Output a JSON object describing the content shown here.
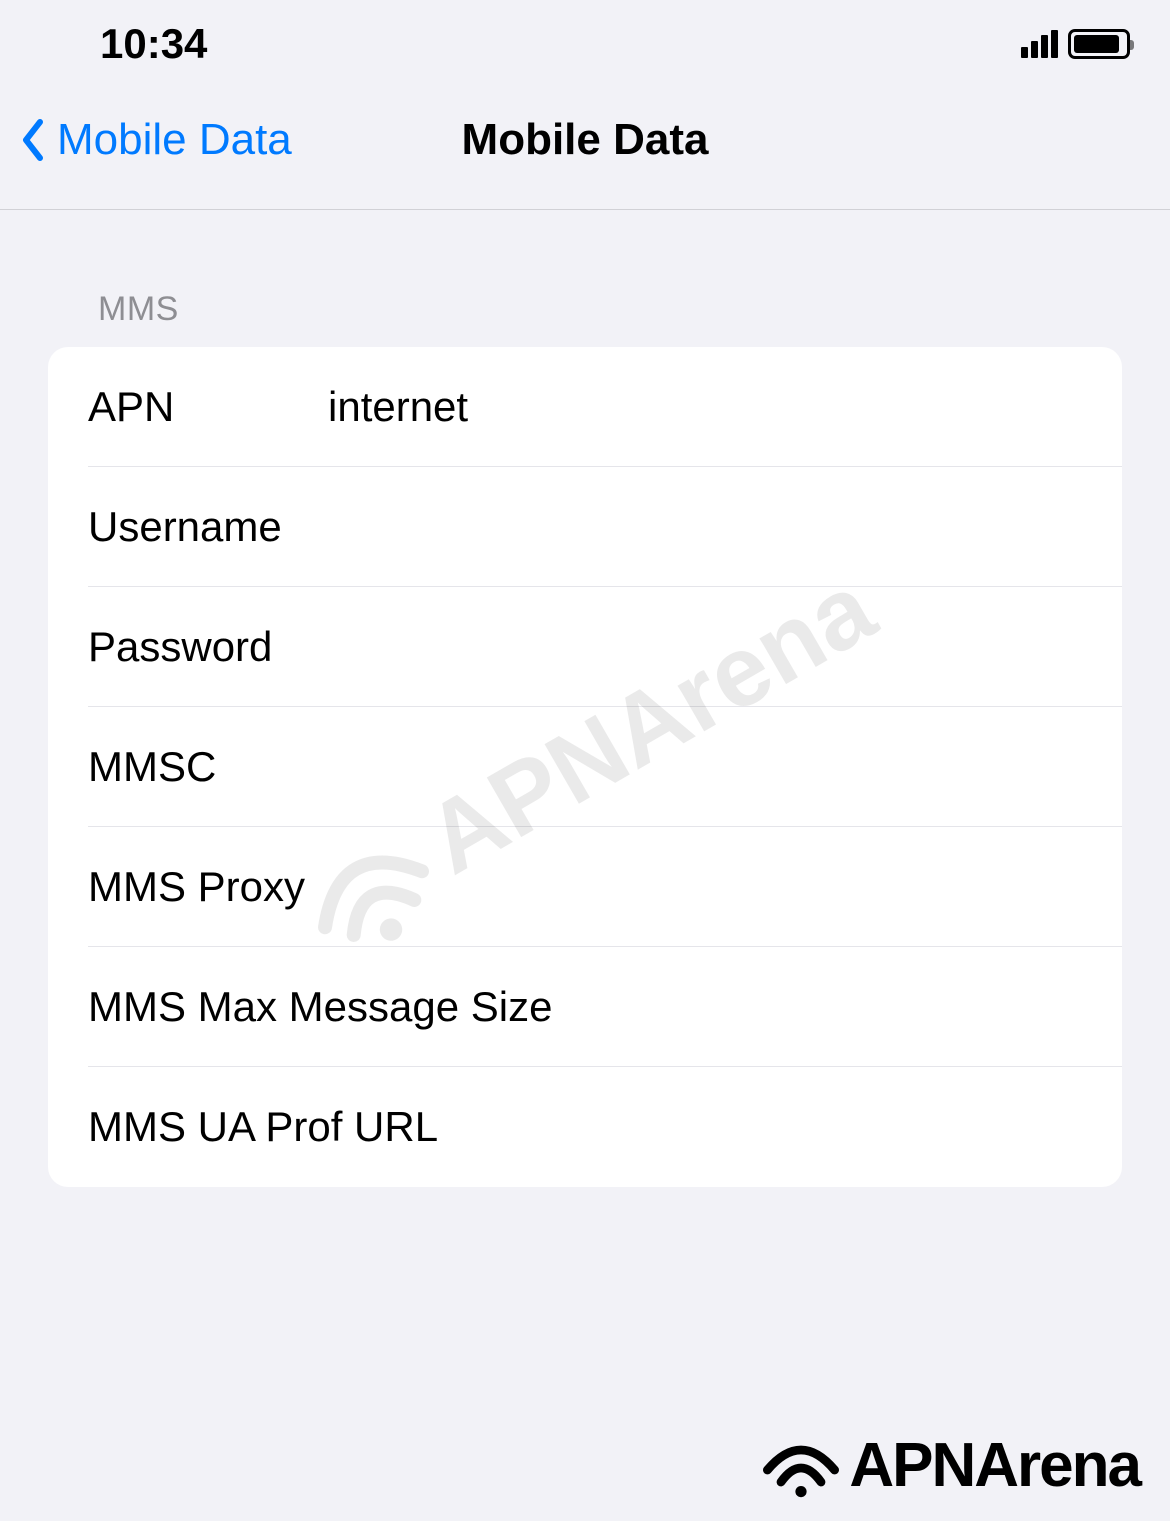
{
  "status_bar": {
    "time": "10:34"
  },
  "nav": {
    "back_label": "Mobile Data",
    "title": "Mobile Data"
  },
  "section": {
    "header": "MMS",
    "rows": [
      {
        "label": "APN",
        "value": "internet"
      },
      {
        "label": "Username",
        "value": ""
      },
      {
        "label": "Password",
        "value": ""
      },
      {
        "label": "MMSC",
        "value": ""
      },
      {
        "label": "MMS Proxy",
        "value": ""
      },
      {
        "label": "MMS Max Message Size",
        "value": ""
      },
      {
        "label": "MMS UA Prof URL",
        "value": ""
      }
    ]
  },
  "brand": {
    "name": "APNArena"
  }
}
